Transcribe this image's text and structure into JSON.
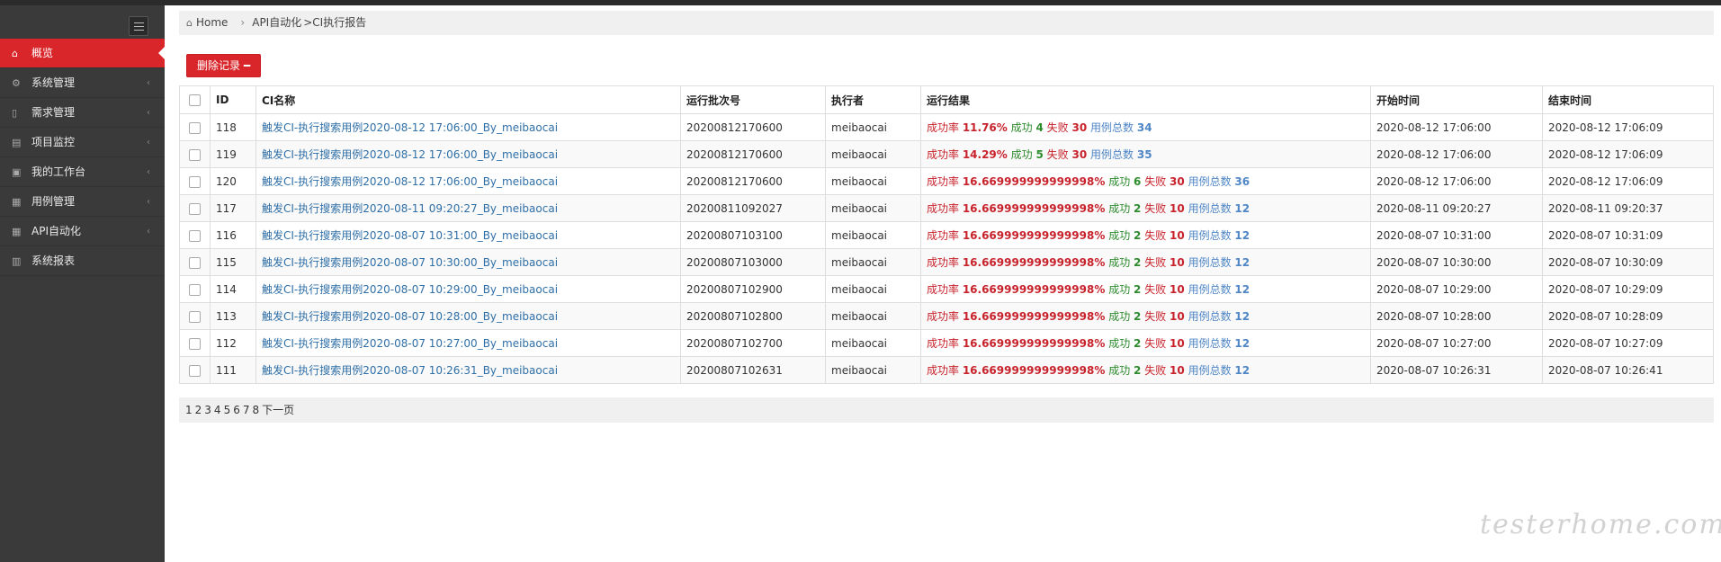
{
  "sidebar": {
    "items": [
      {
        "label": "概览",
        "icon": "home-icon",
        "glyph": "⌂",
        "active": true,
        "chevron": ""
      },
      {
        "label": "系统管理",
        "icon": "cogs-icon",
        "glyph": "⚙",
        "active": false,
        "chevron": "‹"
      },
      {
        "label": "需求管理",
        "icon": "bookmark-icon",
        "glyph": "▯",
        "active": false,
        "chevron": "‹"
      },
      {
        "label": "项目监控",
        "icon": "table-icon",
        "glyph": "▤",
        "active": false,
        "chevron": "‹"
      },
      {
        "label": "我的工作台",
        "icon": "briefcase-icon",
        "glyph": "▣",
        "active": false,
        "chevron": "‹"
      },
      {
        "label": "用例管理",
        "icon": "gift-icon",
        "glyph": "▦",
        "active": false,
        "chevron": "‹"
      },
      {
        "label": "API自动化",
        "icon": "gift-icon",
        "glyph": "▦",
        "active": false,
        "chevron": "‹"
      },
      {
        "label": "系统报表",
        "icon": "bar-chart-icon",
        "glyph": "▥",
        "active": false,
        "chevron": ""
      }
    ]
  },
  "breadcrumb": {
    "home": "Home",
    "sep": "›",
    "second": "API自动化",
    "third": ">CI执行报告"
  },
  "toolbar": {
    "delete_label": "删除记录 ━"
  },
  "table": {
    "headers": {
      "id": "ID",
      "name": "CI名称",
      "batch": "运行批次号",
      "executor": "执行者",
      "result": "运行结果",
      "start": "开始时间",
      "end": "结束时间"
    },
    "result_labels": {
      "rate": "成功率 ",
      "success": "成功 ",
      "fail": "失败 ",
      "total": "用例总数 "
    },
    "rows": [
      {
        "id": "118",
        "name": "触发CI-执行搜索用例2020-08-12 17:06:00_By_meibaocai",
        "batch": "20200812170600",
        "executor": "meibaocai",
        "rate": "11.76%",
        "success": "4",
        "fail": "30",
        "total": "34",
        "start": "2020-08-12 17:06:00",
        "end": "2020-08-12 17:06:09"
      },
      {
        "id": "119",
        "name": "触发CI-执行搜索用例2020-08-12 17:06:00_By_meibaocai",
        "batch": "20200812170600",
        "executor": "meibaocai",
        "rate": "14.29%",
        "success": "5",
        "fail": "30",
        "total": "35",
        "start": "2020-08-12 17:06:00",
        "end": "2020-08-12 17:06:09"
      },
      {
        "id": "120",
        "name": "触发CI-执行搜索用例2020-08-12 17:06:00_By_meibaocai",
        "batch": "20200812170600",
        "executor": "meibaocai",
        "rate": "16.669999999999998%",
        "success": "6",
        "fail": "30",
        "total": "36",
        "start": "2020-08-12 17:06:00",
        "end": "2020-08-12 17:06:09"
      },
      {
        "id": "117",
        "name": "触发CI-执行搜索用例2020-08-11 09:20:27_By_meibaocai",
        "batch": "20200811092027",
        "executor": "meibaocai",
        "rate": "16.669999999999998%",
        "success": "2",
        "fail": "10",
        "total": "12",
        "start": "2020-08-11 09:20:27",
        "end": "2020-08-11 09:20:37"
      },
      {
        "id": "116",
        "name": "触发CI-执行搜索用例2020-08-07 10:31:00_By_meibaocai",
        "batch": "20200807103100",
        "executor": "meibaocai",
        "rate": "16.669999999999998%",
        "success": "2",
        "fail": "10",
        "total": "12",
        "start": "2020-08-07 10:31:00",
        "end": "2020-08-07 10:31:09"
      },
      {
        "id": "115",
        "name": "触发CI-执行搜索用例2020-08-07 10:30:00_By_meibaocai",
        "batch": "20200807103000",
        "executor": "meibaocai",
        "rate": "16.669999999999998%",
        "success": "2",
        "fail": "10",
        "total": "12",
        "start": "2020-08-07 10:30:00",
        "end": "2020-08-07 10:30:09"
      },
      {
        "id": "114",
        "name": "触发CI-执行搜索用例2020-08-07 10:29:00_By_meibaocai",
        "batch": "20200807102900",
        "executor": "meibaocai",
        "rate": "16.669999999999998%",
        "success": "2",
        "fail": "10",
        "total": "12",
        "start": "2020-08-07 10:29:00",
        "end": "2020-08-07 10:29:09"
      },
      {
        "id": "113",
        "name": "触发CI-执行搜索用例2020-08-07 10:28:00_By_meibaocai",
        "batch": "20200807102800",
        "executor": "meibaocai",
        "rate": "16.669999999999998%",
        "success": "2",
        "fail": "10",
        "total": "12",
        "start": "2020-08-07 10:28:00",
        "end": "2020-08-07 10:28:09"
      },
      {
        "id": "112",
        "name": "触发CI-执行搜索用例2020-08-07 10:27:00_By_meibaocai",
        "batch": "20200807102700",
        "executor": "meibaocai",
        "rate": "16.669999999999998%",
        "success": "2",
        "fail": "10",
        "total": "12",
        "start": "2020-08-07 10:27:00",
        "end": "2020-08-07 10:27:09"
      },
      {
        "id": "111",
        "name": "触发CI-执行搜索用例2020-08-07 10:26:31_By_meibaocai",
        "batch": "20200807102631",
        "executor": "meibaocai",
        "rate": "16.669999999999998%",
        "success": "2",
        "fail": "10",
        "total": "12",
        "start": "2020-08-07 10:26:31",
        "end": "2020-08-07 10:26:41"
      }
    ]
  },
  "pager": {
    "pages": [
      "1",
      "2",
      "3",
      "4",
      "5",
      "6",
      "7",
      "8"
    ],
    "next": "下一页"
  },
  "watermark": "testerhome.com",
  "colors": {
    "accent": "#d9262b",
    "sidebar": "#3a3a3a",
    "link": "#2f6fa7",
    "success": "#2e8b2e",
    "fail": "#c8232c",
    "total": "#4f86c6"
  }
}
